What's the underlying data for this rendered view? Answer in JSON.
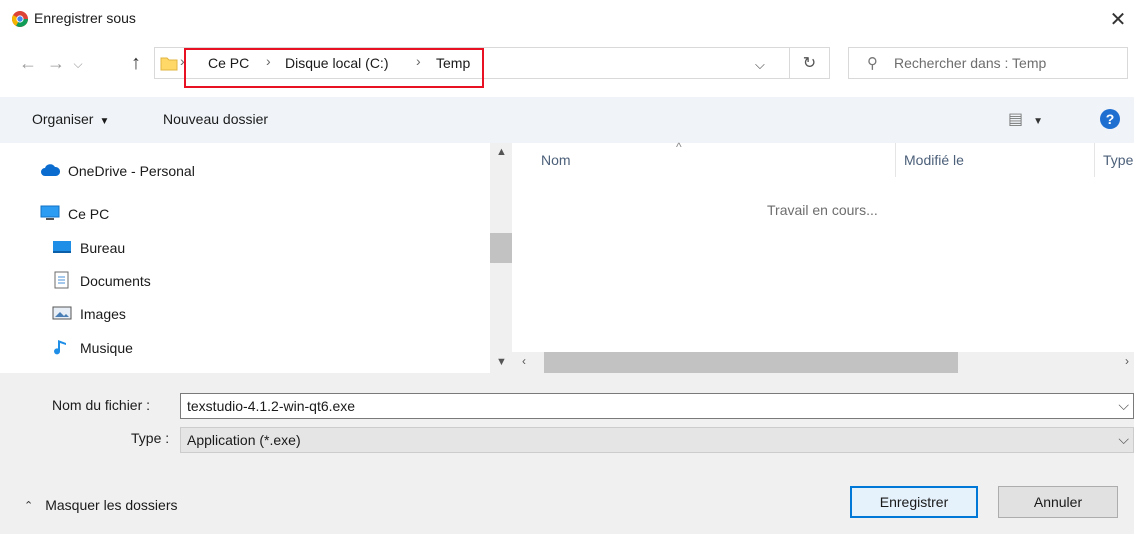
{
  "window": {
    "title": "Enregistrer sous",
    "close_glyph": "✕"
  },
  "nav": {
    "back_glyph": "←",
    "forward_glyph": "→",
    "recent_glyph": "⌵",
    "up_glyph": "↑",
    "breadcrumb": [
      "Ce PC",
      "Disque local (C:)",
      "Temp"
    ],
    "sep": "›",
    "refresh_glyph": "↻",
    "search_placeholder": "Rechercher dans : Temp"
  },
  "toolbar": {
    "organize_label": "Organiser",
    "new_folder_label": "Nouveau dossier",
    "view_glyph": "▤",
    "help_glyph": "?"
  },
  "tree": {
    "items": [
      {
        "label": "OneDrive - Personal",
        "icon": "cloud-icon"
      },
      {
        "label": "Ce PC",
        "icon": "pc-icon"
      },
      {
        "label": "Bureau",
        "icon": "desktop-icon"
      },
      {
        "label": "Documents",
        "icon": "documents-icon"
      },
      {
        "label": "Images",
        "icon": "images-icon"
      },
      {
        "label": "Musique",
        "icon": "music-icon"
      }
    ]
  },
  "filelist": {
    "columns": [
      "Nom",
      "Modifié le",
      "Type"
    ],
    "status": "Travail en cours..."
  },
  "form": {
    "filename_label": "Nom du fichier :",
    "filename_value": "texstudio-4.1.2-win-qt6.exe",
    "type_label": "Type :",
    "type_value": "Application (*.exe)"
  },
  "footer": {
    "hide_folders_label": "Masquer les dossiers",
    "save_label": "Enregistrer",
    "cancel_label": "Annuler"
  },
  "colors": {
    "accent": "#0078d7",
    "highlight": "#e81123",
    "help": "#1f6fd1"
  }
}
